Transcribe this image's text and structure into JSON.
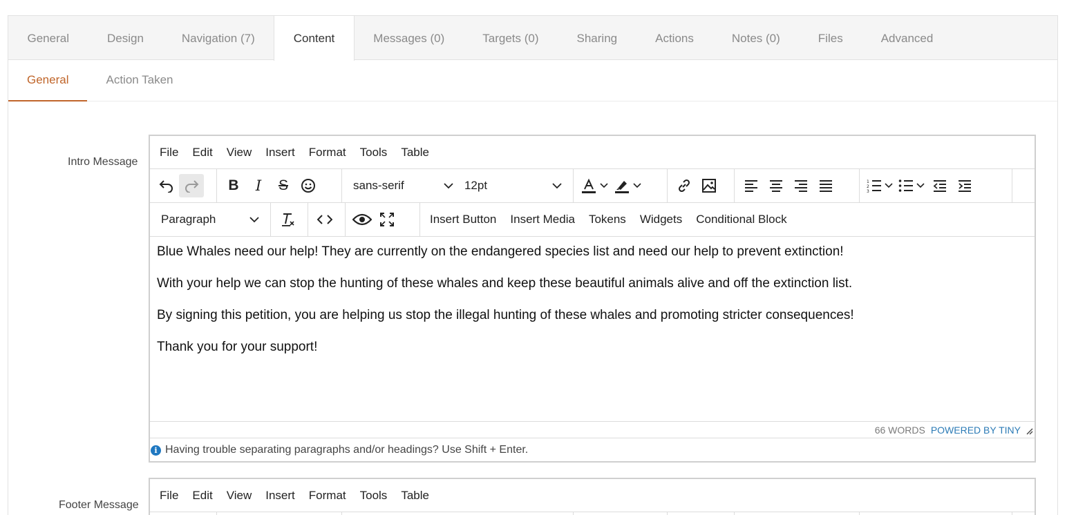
{
  "main_tabs": [
    {
      "label": "General"
    },
    {
      "label": "Design"
    },
    {
      "label": "Navigation (7)"
    },
    {
      "label": "Content",
      "active": true
    },
    {
      "label": "Messages (0)"
    },
    {
      "label": "Targets (0)"
    },
    {
      "label": "Sharing"
    },
    {
      "label": "Actions"
    },
    {
      "label": "Notes (0)"
    },
    {
      "label": "Files"
    },
    {
      "label": "Advanced"
    }
  ],
  "sub_tabs": [
    {
      "label": "General",
      "active": true
    },
    {
      "label": "Action Taken"
    }
  ],
  "intro": {
    "label": "Intro Message",
    "menu": [
      "File",
      "Edit",
      "View",
      "Insert",
      "Format",
      "Tools",
      "Table"
    ],
    "font_family": "sans-serif",
    "font_size": "12pt",
    "block_format": "Paragraph",
    "custom_buttons": [
      "Insert Button",
      "Insert Media",
      "Tokens",
      "Widgets",
      "Conditional Block"
    ],
    "paragraphs": [
      "Blue Whales need our help! They are currently on the endangered species list and need our help to prevent extinction!",
      "With your help we can stop the hunting of these whales and keep these beautiful animals alive and off the extinction list.",
      "By signing this petition, you are helping us stop the illegal hunting of these whales and promoting stricter consequences!",
      "Thank you for your support!"
    ],
    "word_count": "66 WORDS",
    "powered_by": "POWERED BY TINY",
    "hint": "Having trouble separating paragraphs and/or headings? Use Shift + Enter."
  },
  "footer": {
    "label": "Footer Message",
    "menu": [
      "File",
      "Edit",
      "View",
      "Insert",
      "Format",
      "Tools",
      "Table"
    ]
  },
  "colors": {
    "accent": "#c0652a",
    "link": "#2c7bb6",
    "info": "#1f78c1"
  }
}
